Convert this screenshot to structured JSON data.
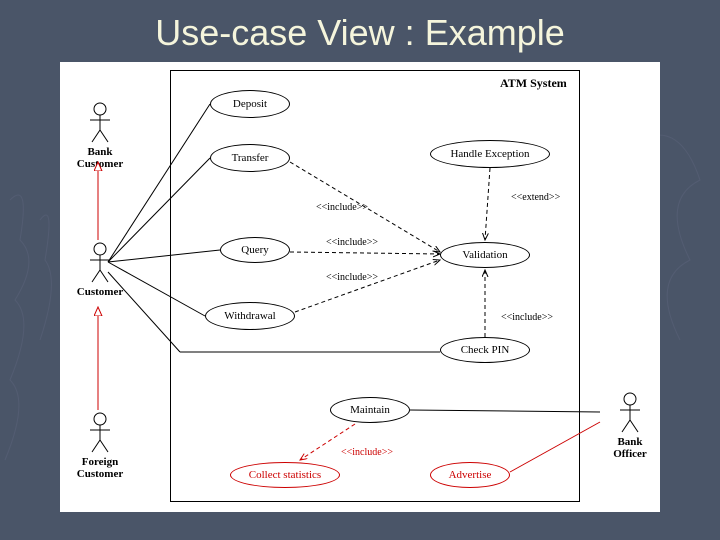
{
  "title": "Use-case View : Example",
  "system_label": "ATM System",
  "actors": {
    "bank_customer": "Bank Customer",
    "customer": "Customer",
    "foreign_customer": "Foreign\nCustomer",
    "bank_officer": "Bank\nOfficer"
  },
  "usecases": {
    "deposit": "Deposit",
    "transfer": "Transfer",
    "query": "Query",
    "withdrawal": "Withdrawal",
    "maintain": "Maintain",
    "handle_exception": "Handle Exception",
    "validation": "Validation",
    "check_pin": "Check PIN",
    "collect_statistics": "Collect statistics",
    "advertise": "Advertise"
  },
  "stereotypes": {
    "include": "<<include>>",
    "extend": "<<extend>>"
  }
}
